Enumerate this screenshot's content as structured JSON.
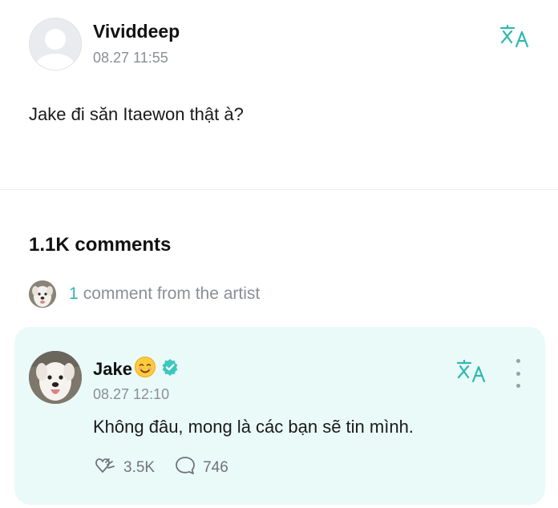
{
  "post": {
    "author": "Vividdeep",
    "time": "08.27 11:55",
    "text": "Jake đi săn Itaewon thật à?",
    "translate_icon": "translate-icon"
  },
  "comments": {
    "count_label": "1.1K comments",
    "artist_count": "1",
    "artist_text": "comment from the artist"
  },
  "artist_comment": {
    "author": "Jake",
    "time": "08.27 12:10",
    "text": "Không đâu, mong là các bạn sẽ tin mình.",
    "likes": "3.5K",
    "replies": "746",
    "icons": [
      "smile-emoji-icon",
      "verified-badge-icon",
      "translate-icon",
      "more-vertical-icon",
      "like-icon",
      "comment-icon"
    ]
  },
  "colors": {
    "accent": "#2fb8b0",
    "card_bg": "#eafaf8",
    "muted_text": "#8a8f96"
  }
}
